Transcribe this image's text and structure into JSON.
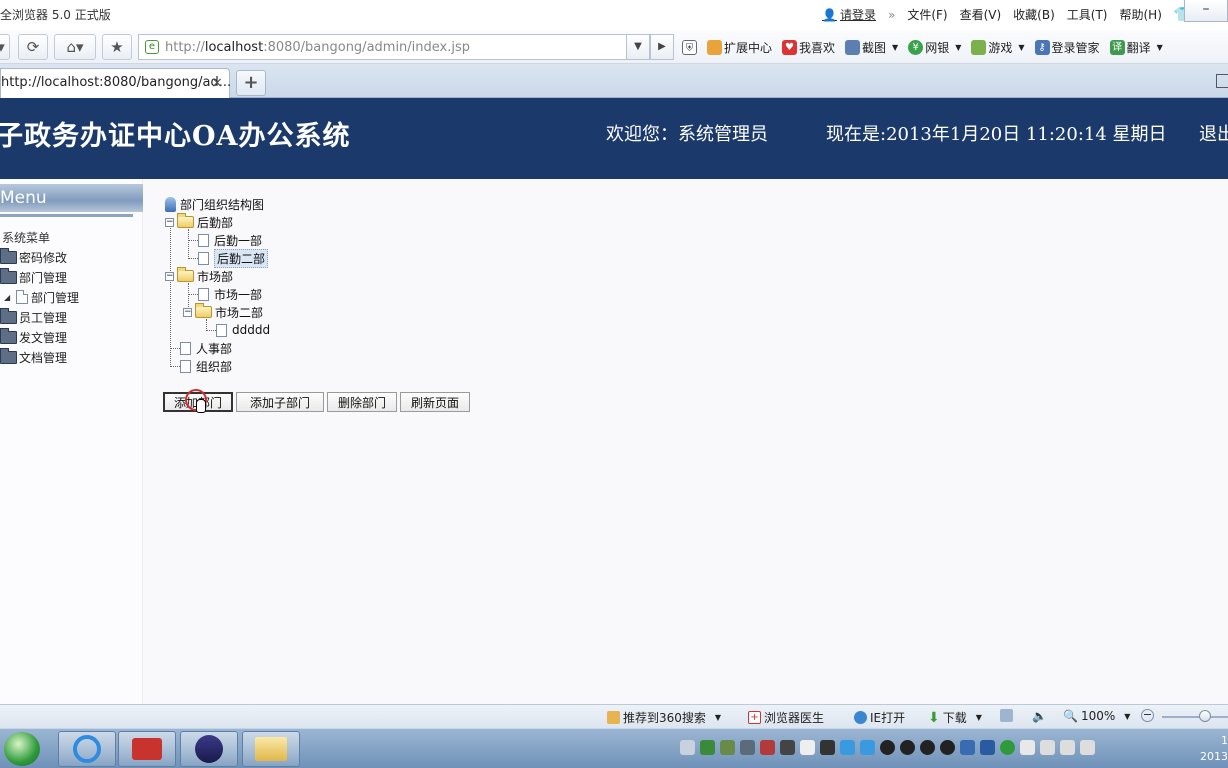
{
  "browser": {
    "app_title": "全浏览器 5.0 正式版",
    "login_link": "请登录",
    "menu_items": [
      "文件(F)",
      "查看(V)",
      "收藏(B)",
      "工具(T)",
      "帮助(H)"
    ],
    "minimize_glyph": "–",
    "address_prefix": "http://",
    "address_host": "localhost",
    "address_rest": ":8080/bangong/admin/index.jsp",
    "toolbar_items": [
      "扩展中心",
      "我喜欢",
      "截图",
      "网银",
      "游戏",
      "登录管家",
      "翻译"
    ],
    "tab_title": "http://localhost:8080/bangong/ad...",
    "tab_close": "×",
    "new_tab": "+"
  },
  "header": {
    "system_title": "子政务办证中心OA办公系统",
    "welcome": "欢迎您：系统管理员",
    "datetime": "现在是:2013年1月20日  11:20:14 星期日",
    "logout": "退出"
  },
  "sidebar": {
    "menu_title": "Menu",
    "root_label": "系统菜单",
    "items": [
      {
        "label": "密码修改",
        "type": "folder"
      },
      {
        "label": "部门管理",
        "type": "folder"
      },
      {
        "label": "部门管理",
        "type": "page"
      },
      {
        "label": "员工管理",
        "type": "folder"
      },
      {
        "label": "发文管理",
        "type": "folder"
      },
      {
        "label": "文档管理",
        "type": "folder"
      }
    ]
  },
  "tree": {
    "root_label": "部门组织结构图",
    "nodes": [
      "后勤部",
      "后勤一部",
      "后勤二部",
      "市场部",
      "市场一部",
      "市场二部",
      "ddddd",
      "人事部",
      "组织部"
    ],
    "selected": "后勤二部"
  },
  "actions": {
    "add_dept": "添加部门",
    "add_sub_dept": "添加子部门",
    "delete_dept": "删除部门",
    "refresh": "刷新页面"
  },
  "statusbar": {
    "recommend": "推荐到360搜索",
    "doctor": "浏览器医生",
    "ie_open": "IE打开",
    "download": "下载",
    "zoom": "100%"
  },
  "taskbar": {
    "clock_time": "1",
    "clock_year": "2013"
  }
}
